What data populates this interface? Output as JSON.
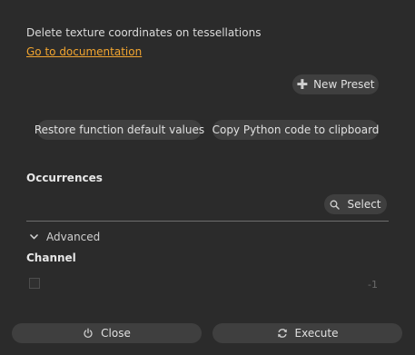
{
  "description": "Delete texture coordinates on tessellations",
  "doc_link": "Go to documentation",
  "presets": {
    "new_label": "New Preset",
    "new_icon": "plus-icon"
  },
  "actions": {
    "restore_label": "Restore function default values",
    "copy_label": "Copy Python code to clipboard"
  },
  "occurrences": {
    "title": "Occurrences",
    "select_label": "Select",
    "select_icon": "search-icon"
  },
  "advanced": {
    "label": "Advanced",
    "icon": "chevron-down-icon",
    "expanded": true
  },
  "channel": {
    "title": "Channel",
    "checked": false,
    "value": "-1"
  },
  "footer": {
    "close_label": "Close",
    "close_icon": "power-icon",
    "execute_label": "Execute",
    "execute_icon": "refresh-icon"
  },
  "colors": {
    "background": "#2b2b2b",
    "button": "#3f3f3f",
    "link": "#f2a530"
  }
}
